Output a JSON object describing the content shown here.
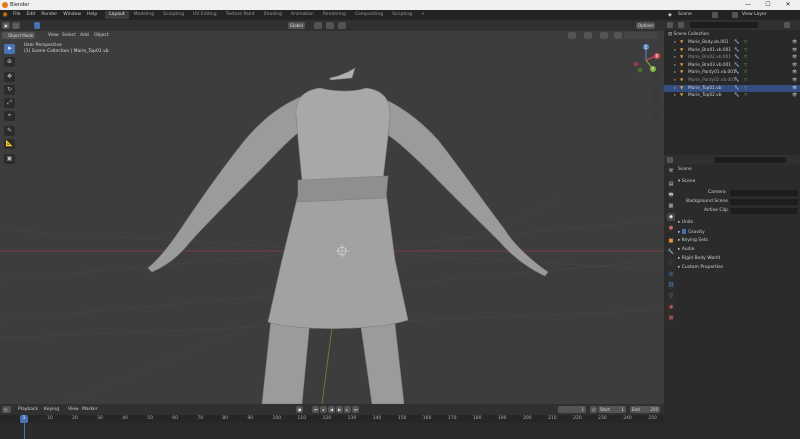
{
  "window": {
    "title": "Blender",
    "minimize": "—",
    "maximize": "☐",
    "close": "✕"
  },
  "menu": [
    "File",
    "Edit",
    "Render",
    "Window",
    "Help"
  ],
  "workspaces": [
    "Layout",
    "Modeling",
    "Sculpting",
    "UV Editing",
    "Texture Paint",
    "Shading",
    "Animation",
    "Rendering",
    "Compositing",
    "Scripting"
  ],
  "active_workspace": "Layout",
  "add_workspace": "+",
  "topbar_right": {
    "scene_label": "Scene",
    "view_layer_label": "View Layer"
  },
  "viewport": {
    "mode": "Object Mode",
    "menus": [
      "View",
      "Select",
      "Add",
      "Object"
    ],
    "orientation": "Global",
    "options": "Options",
    "overlay_line1": "User Perspective",
    "overlay_line2": "(1) Scene Collection | Marie_Top01.vb"
  },
  "gizmo": {
    "z": "Z",
    "y": "Y",
    "x": "X"
  },
  "outliner": {
    "root": "Scene Collection",
    "items": [
      {
        "name": "Marie_Body.vb.001",
        "selected": false,
        "dim": false
      },
      {
        "name": "Marie_Bra01.vb.001",
        "selected": false,
        "dim": false
      },
      {
        "name": "Marie_Bra02.vb.001",
        "selected": false,
        "dim": true
      },
      {
        "name": "Marie_Bra03.vb.001",
        "selected": false,
        "dim": false
      },
      {
        "name": "Marie_Panty01.vb.001",
        "selected": false,
        "dim": false
      },
      {
        "name": "Marie_Panty02.vb.001",
        "selected": false,
        "dim": true
      },
      {
        "name": "Marie_Top01.vb",
        "selected": true,
        "dim": false
      },
      {
        "name": "Marie_Top02.vb",
        "selected": false,
        "dim": false
      }
    ]
  },
  "properties": {
    "header": "Scene",
    "panel": "Scene",
    "fields": [
      {
        "label": "Camera"
      },
      {
        "label": "Background Scene"
      },
      {
        "label": "Active Clip"
      }
    ],
    "sections": [
      "Units",
      "Gravity",
      "Keying Sets",
      "Audio",
      "Rigid Body World",
      "Custom Properties"
    ],
    "gravity_checked": true
  },
  "timeline": {
    "menus": [
      "Playback",
      "Keying",
      "View",
      "Marker"
    ],
    "current_frame": "1",
    "start_label": "Start",
    "start_value": "1",
    "end_label": "End",
    "end_value": "250",
    "ruler": [
      "0",
      "10",
      "20",
      "30",
      "40",
      "50",
      "60",
      "70",
      "80",
      "90",
      "100",
      "110",
      "120",
      "130",
      "140",
      "150",
      "160",
      "170",
      "180",
      "190",
      "200",
      "210",
      "220",
      "230",
      "240",
      "250"
    ],
    "marker_frame": "1"
  },
  "colors": {
    "accent": "#4772b3",
    "selected_row": "#334d80",
    "orange": "#e87d0d",
    "viewport": "#3d3d3d"
  }
}
